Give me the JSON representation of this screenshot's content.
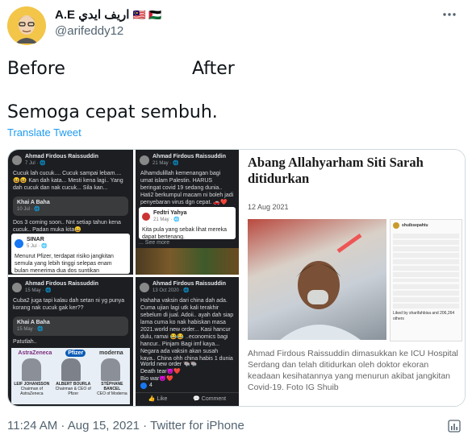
{
  "tweet": {
    "display_name": "A.E اريف ايدي",
    "flags": "🇲🇾 🇵🇸",
    "handle": "@arifeddy12",
    "more_icon": "more-horizontal-icon",
    "line_before": "Before",
    "line_after": "After",
    "line_main": "Semoga cepat sembuh.",
    "translate": "Translate Tweet",
    "time": "11:24 AM · Aug 15, 2021 · Twitter for iPhone",
    "analytics_icon": "analytics-icon"
  },
  "media": {
    "tl": {
      "name": "Ahmad Firdous Raissuddin",
      "time": "7 Jul · 🌐",
      "text": "Cucuk lah cucuk.... Cucuk sampai lebam.... 😆😆 Kan dah kata... Mesti kena lagi.. Yang dah cucuk dan nak cucuk... Sila kan...",
      "reply_name": "Khai A Baha",
      "reply_time": "10 Jul · 🌐",
      "reply_text": "Dos 3 coming soon.. Nnt setiap tahun kena cucuk.. Padan muka kita😄",
      "sinar": "SINAR",
      "sinar_time": "5 Jul · 🌐",
      "sinar_text": "Menurut Pfizer, terdapat risiko jangkitan semula yang lebih tinggi selepas enam bulan menerima dua dos suntikan"
    },
    "tm": {
      "name": "Ahmad Firdous Raissuddin",
      "time": "21 May · 🌐",
      "text": "Alhamdulillah kemenangan bagi umat islam Palestin. HARUS beringat covid 19 sedang dunia.. Hati2 berkumpul macam ni boleh jadi penyebaran virus dgn cepat. 🚗❤️",
      "reply_name": "Fedtri Yahya",
      "reply_time": "21 May · 🌐",
      "reply_text": "Kita pula yang sebak lihat mereka dapat bertenang.",
      "see_more": "... See more"
    },
    "bl": {
      "name": "Ahmad Firdous Raissuddin",
      "time": "15 May · 🌐",
      "text": "Cuba2 juga tapi kalau dah setan ni yg punya korang nak cucuk gak ker??",
      "reply_name": "Khai A Baha",
      "reply_time": "15 May · 🌐",
      "reply_text": "Patutlah..",
      "brands": [
        "AstraZeneca",
        "Pfizer",
        "moderna"
      ],
      "people": [
        {
          "name": "LEIF JOHANSSON",
          "role": "Chairman of AstraZeneca"
        },
        {
          "name": "ALBERT BOURLA",
          "role": "Chairman & CEO of Pfizer"
        },
        {
          "name": "STÉPHANE BANCEL",
          "role": "CEO of Moderna"
        }
      ]
    },
    "bm": {
      "name": "Ahmad Firdous Raissuddin",
      "time": "13 Oct 2020 · 🌐",
      "text": "Hahaha vaksin dari china dah ada. Cuma ujian lagi utk kali terakhir sebelum di jual. Adoii.. ayah dah siap lama cuma ko nak habiskan masa 2021.world new order... Kasi hancur dulu, ramai 😂😂 ..economics bagi hancur.. Pinjam Bagi imf kaya... Negara ada vaksin akan susah kaya.. China ohh china habis 1 dunia ko game..",
      "lines": [
        "World new order 🐃🐃",
        "Death tear😈❤️",
        "Bio war😈❤️"
      ],
      "count": "4",
      "like": "Like",
      "comment": "Comment"
    },
    "article": {
      "headline": "Abang Allahyarham Siti Sarah ditidurkan",
      "date": "12 Aug 2021",
      "caption": "Ahmad Firdous Raissuddin dimasukkan ke ICU Hospital Serdang dan telah ditidurkan oleh doktor ekoran keadaan kesihatannya yang menurun akibat jangkitan Covid-19. Foto IG Shuib",
      "ig_user": "shuibsepahtu",
      "ig_likes": "Liked by sharifahbisa and 206,264 others"
    }
  }
}
